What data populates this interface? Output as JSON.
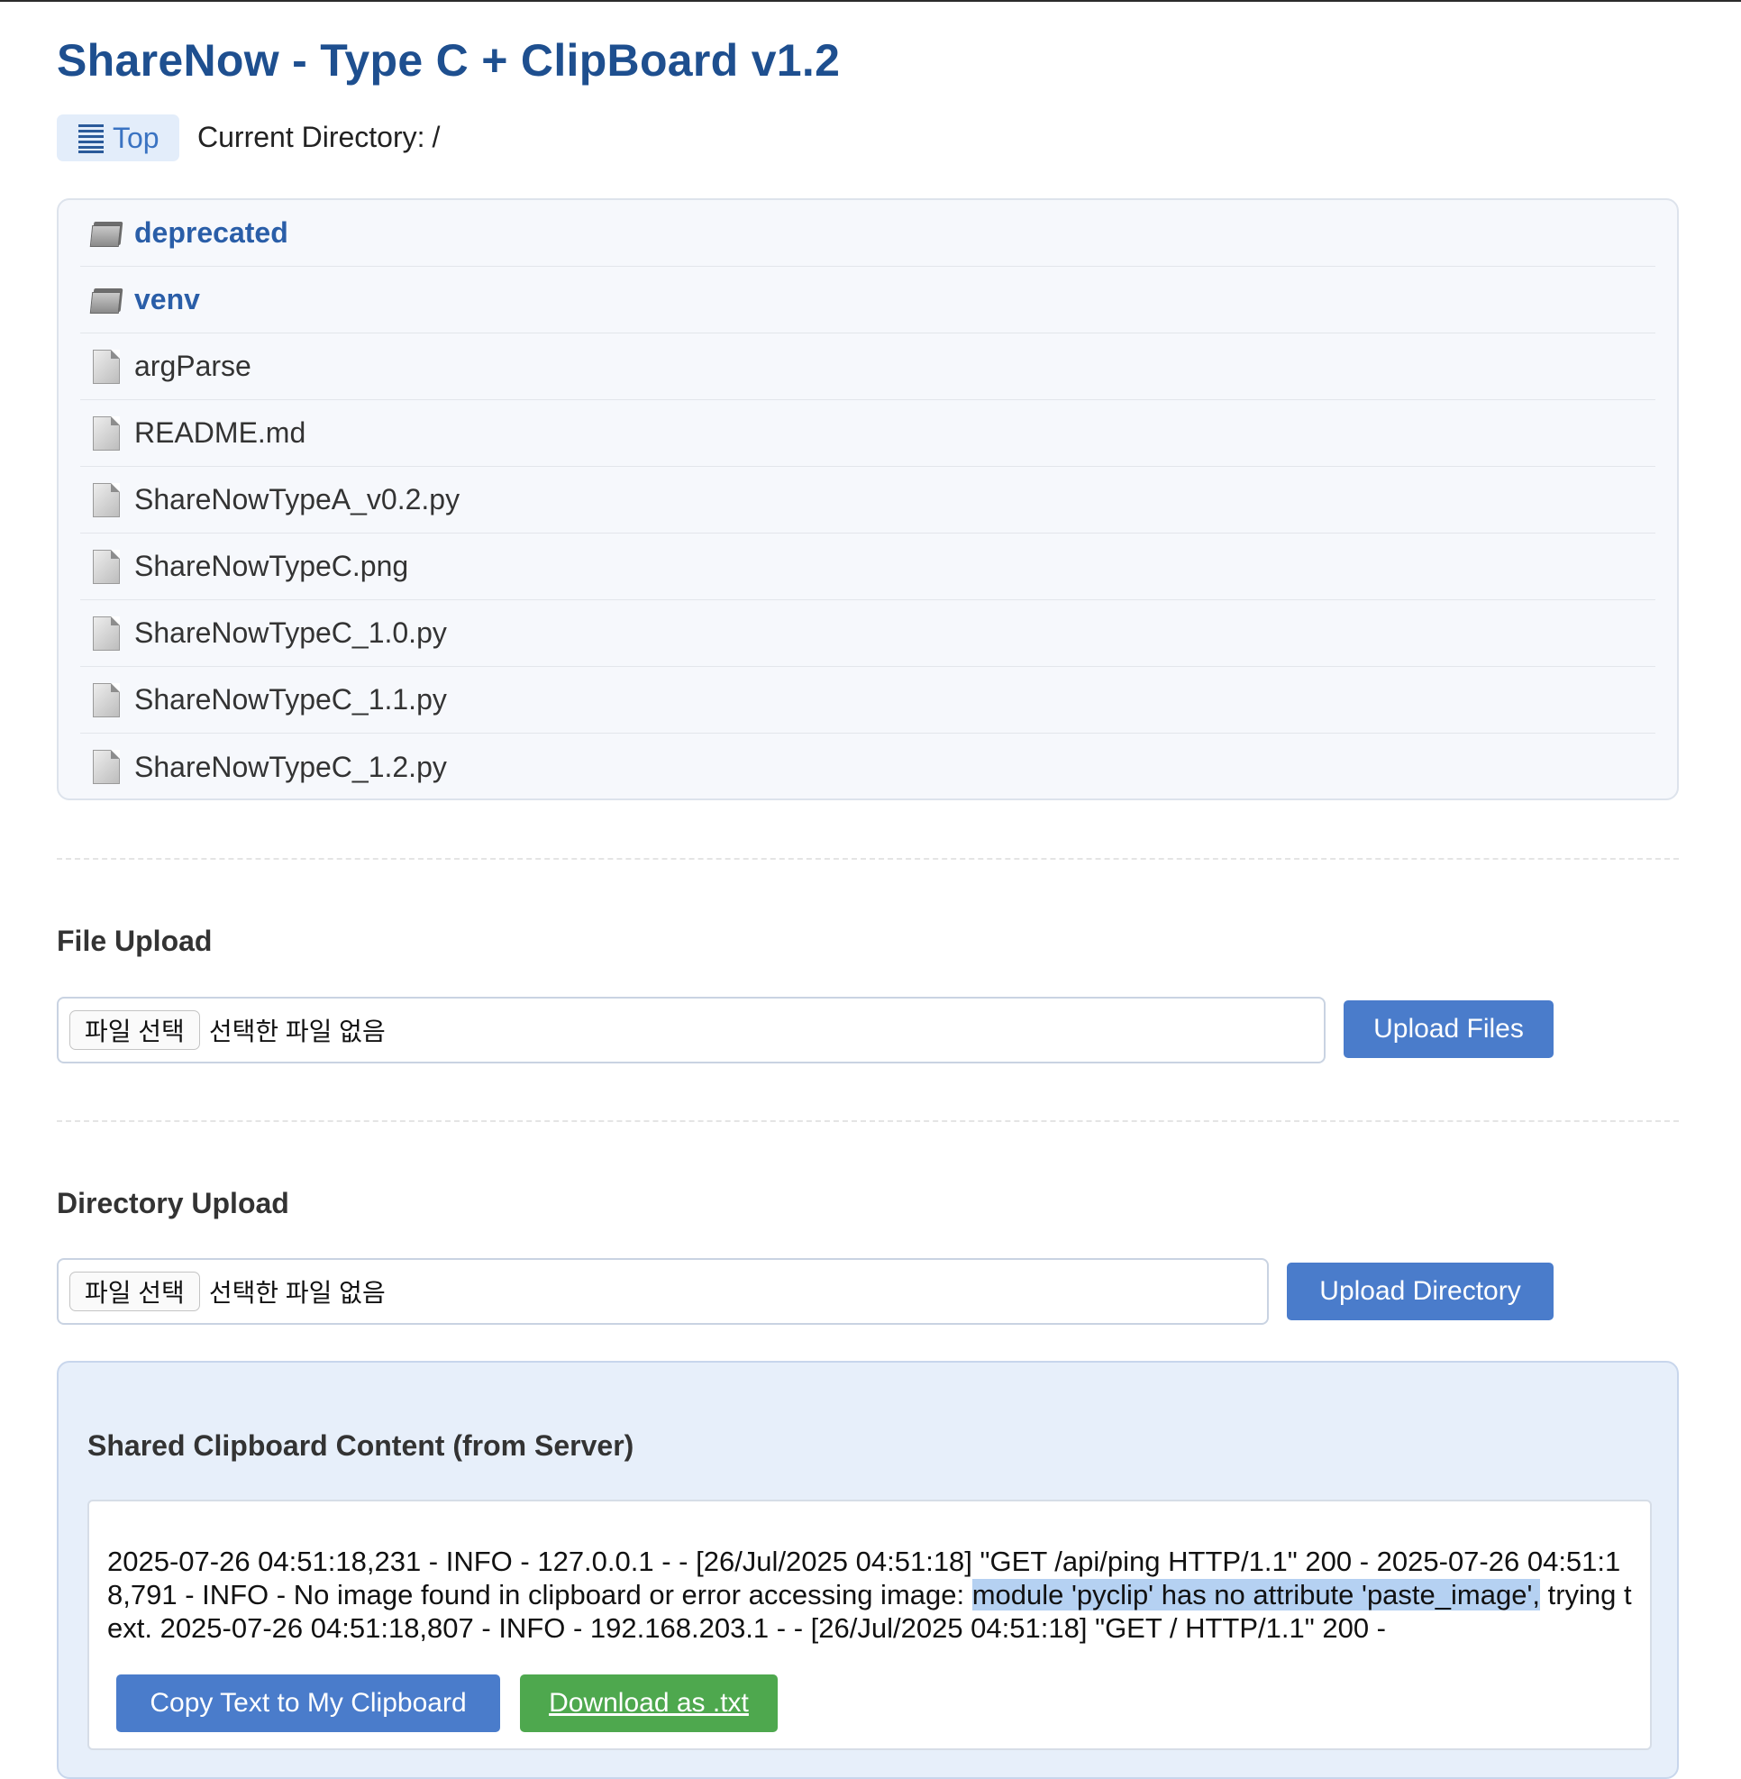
{
  "title": "ShareNow - Type C + ClipBoard v1.2",
  "nav": {
    "top_label": "Top",
    "current_dir_label": "Current Directory:",
    "current_dir_value": "/"
  },
  "listing": [
    {
      "type": "dir",
      "name": "deprecated",
      "icon": "folder-icon"
    },
    {
      "type": "dir",
      "name": "venv",
      "icon": "folder-icon"
    },
    {
      "type": "file",
      "name": "argParse",
      "icon": "document-icon"
    },
    {
      "type": "file",
      "name": "README.md",
      "icon": "document-icon"
    },
    {
      "type": "file",
      "name": "ShareNowTypeA_v0.2.py",
      "icon": "document-icon"
    },
    {
      "type": "file",
      "name": "ShareNowTypeC.png",
      "icon": "document-icon"
    },
    {
      "type": "file",
      "name": "ShareNowTypeC_1.0.py",
      "icon": "document-icon"
    },
    {
      "type": "file",
      "name": "ShareNowTypeC_1.1.py",
      "icon": "document-icon"
    },
    {
      "type": "file",
      "name": "ShareNowTypeC_1.2.py",
      "icon": "document-icon"
    }
  ],
  "file_upload": {
    "heading": "File Upload",
    "choose_label": "파일 선택",
    "no_file_label": "선택한 파일 없음",
    "button_label": "Upload Files"
  },
  "directory_upload": {
    "heading": "Directory Upload",
    "choose_label": "파일 선택",
    "no_file_label": "선택한 파일 없음",
    "button_label": "Upload Directory"
  },
  "clipboard": {
    "heading": "Shared Clipboard Content (from Server)",
    "text_before": "2025-07-26 04:51:18,231 - INFO - 127.0.0.1 - - [26/Jul/2025 04:51:18] \"GET /api/ping HTTP/1.1\" 200 - 2025-07-26 04:51:18,791 - INFO - No image found in clipboard or error accessing image: ",
    "text_selected": "module 'pyclip' has no attribute 'paste_image',",
    "text_after": " trying text. 2025-07-26 04:51:18,807 - INFO - 192.168.203.1 - - [26/Jul/2025 04:51:18] \"GET / HTTP/1.1\" 200 -",
    "copy_label": "Copy Text to My Clipboard",
    "download_label": "Download as .txt"
  },
  "colors": {
    "title": "#1e4f8f",
    "primary_button": "#4a7ccb",
    "download_button": "#4ea84e",
    "selection": "#b5d1f2"
  }
}
